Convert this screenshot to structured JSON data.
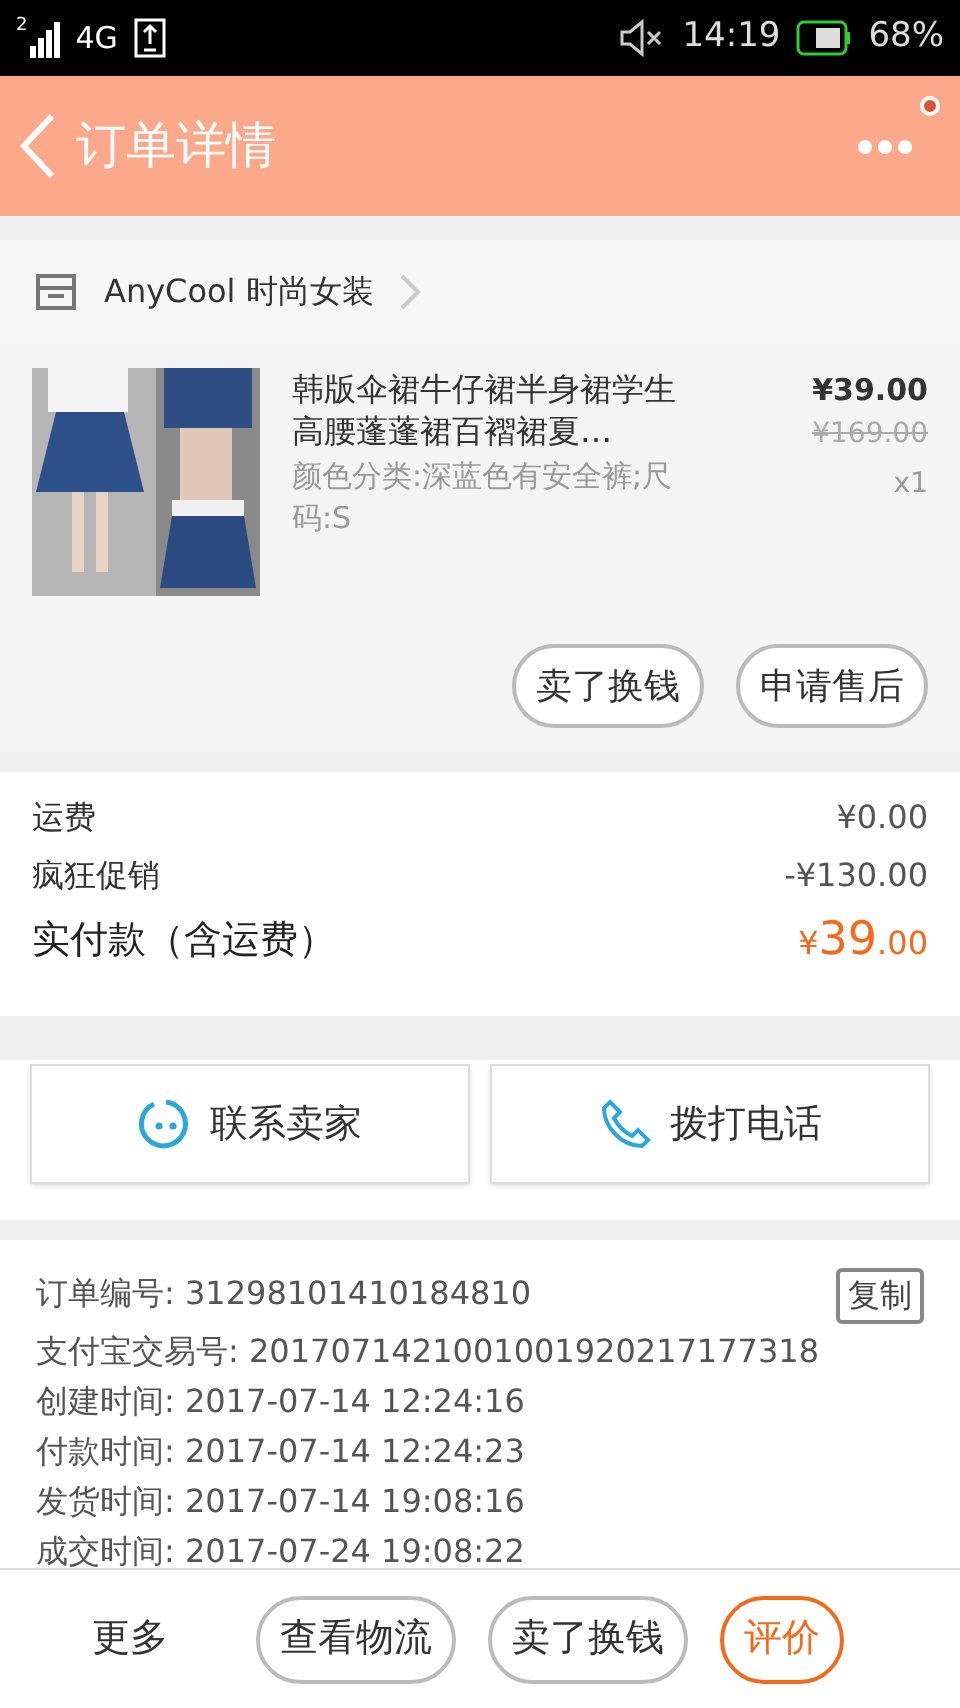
{
  "status_bar": {
    "signal": "2",
    "network": "4G",
    "time": "14:19",
    "battery": "68%"
  },
  "header": {
    "title": "订单详情",
    "has_notification": true
  },
  "shop": {
    "name": "AnyCool 时尚女装"
  },
  "product": {
    "kind": "picture",
    "title": "韩版伞裙牛仔裙半身裙学生高腰蓬蓬裙百褶裙夏…",
    "spec": "颜色分类:深蓝色有安全裤;尺码:S",
    "price": "¥39.00",
    "original_price": "¥169.00",
    "quantity": "x1",
    "actions": [
      "卖了换钱",
      "申请售后"
    ]
  },
  "fees": [
    {
      "label": "运费",
      "value": "¥0.00"
    },
    {
      "label": "疯狂促销",
      "value": "-¥130.00"
    }
  ],
  "total": {
    "label": "实付款（含运费）",
    "currency": "¥",
    "integer": "39",
    "decimal": ".00"
  },
  "contact": [
    {
      "kind": "chat",
      "label": "联系卖家"
    },
    {
      "kind": "phone",
      "label": "拨打电话"
    }
  ],
  "order_info": {
    "copy_label": "复制",
    "lines": [
      "订单编号: 31298101410184810",
      "支付宝交易号: 2017071421001001920217177318",
      "创建时间: 2017-07-14 12:24:16",
      "付款时间: 2017-07-14 12:24:23",
      "发货时间: 2017-07-14 19:08:16",
      "成交时间: 2017-07-24 19:08:22"
    ]
  },
  "bottom_bar": {
    "more": "更多",
    "buttons": [
      {
        "label": "查看物流",
        "highlighted": false
      },
      {
        "label": "卖了换钱",
        "highlighted": false
      },
      {
        "label": "评价",
        "highlighted": true
      }
    ]
  }
}
